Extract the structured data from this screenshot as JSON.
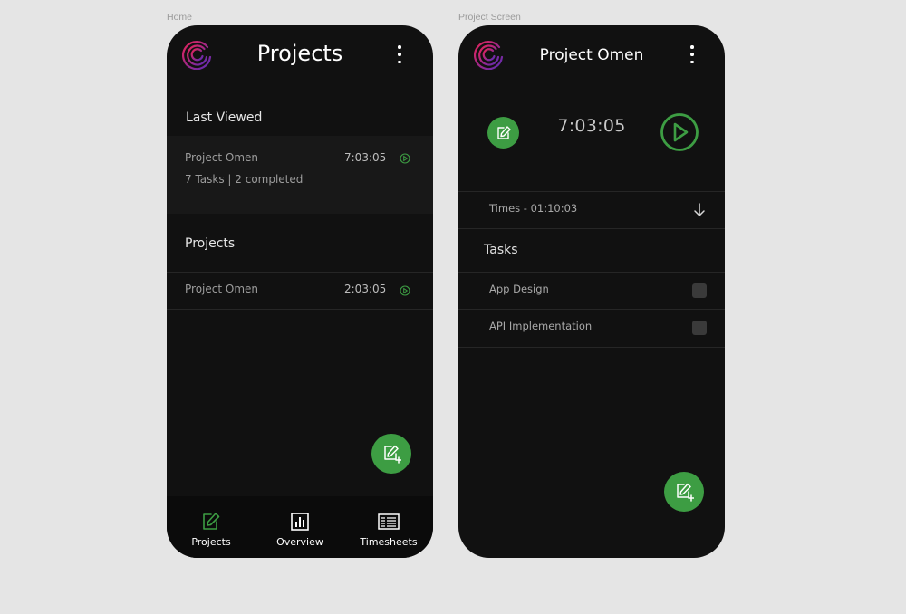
{
  "frames": {
    "home_label": "Home",
    "project_label": "Project Screen"
  },
  "colors": {
    "background": "#e5e5e5",
    "phone": "#111111",
    "accent_green": "#3d9d43",
    "logo_gradient": [
      "#e5245a",
      "#5b2bb5"
    ]
  },
  "home": {
    "title": "Projects",
    "last_viewed": {
      "heading": "Last Viewed",
      "project_name": "Project Omen",
      "time": "7:03:05",
      "summary": "7 Tasks | 2 completed"
    },
    "projects": {
      "heading": "Projects",
      "items": [
        {
          "name": "Project Omen",
          "time": "2:03:05"
        }
      ]
    },
    "nav": [
      {
        "label": "Projects",
        "icon": "edit-icon",
        "active": true
      },
      {
        "label": "Overview",
        "icon": "bar-chart-icon",
        "active": false
      },
      {
        "label": "Timesheets",
        "icon": "timesheet-icon",
        "active": false
      }
    ]
  },
  "project": {
    "title": "Project Omen",
    "timer": "7:03:05",
    "times_label": "Times - 01:10:03",
    "tasks_heading": "Tasks",
    "tasks": [
      {
        "name": "App Design"
      },
      {
        "name": "API Implementation"
      }
    ]
  }
}
